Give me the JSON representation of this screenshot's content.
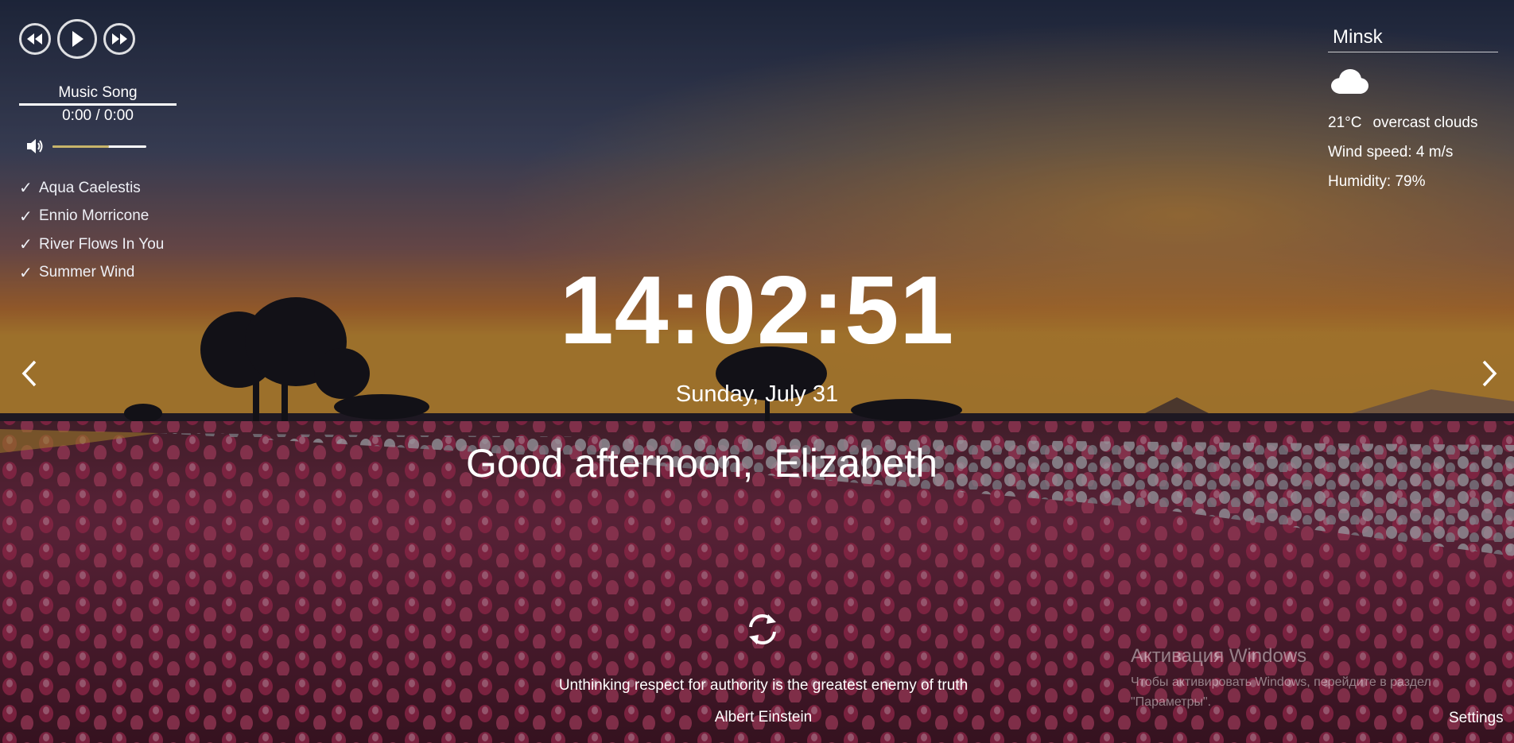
{
  "player": {
    "song_title": "Music Song",
    "time_display": "0:00 / 0:00",
    "volume_level": 0.6,
    "playlist": [
      {
        "title": "Aqua Caelestis"
      },
      {
        "title": "Ennio Morricone"
      },
      {
        "title": "River Flows In You"
      },
      {
        "title": "Summer Wind"
      }
    ],
    "check_mark": "✓",
    "icons": {
      "prev": "rewind-icon",
      "play": "play-icon",
      "next": "fast-forward-icon",
      "volume": "speaker-icon"
    }
  },
  "weather": {
    "city": "Minsk",
    "icon": "cloud-icon",
    "temperature": "21°C",
    "description": "overcast clouds",
    "wind": "Wind speed: 4 m/s",
    "humidity": "Humidity: 79%"
  },
  "clock": {
    "time": "14:02:51",
    "date": "Sunday, July 31"
  },
  "greeting": {
    "text": "Good afternoon,",
    "name": "Elizabeth"
  },
  "quote": {
    "text": "Unthinking respect for authority is the greatest enemy of truth",
    "author": "Albert Einstein",
    "refresh_icon": "refresh-icon"
  },
  "watermark": {
    "title": "Активация Windows",
    "subtitle": "Чтобы активировать Windows, перейдите в раздел \"Параметры\"."
  },
  "settings": {
    "label": "Settings"
  },
  "colors": {
    "text": "#ffffff",
    "volume_fill": "#c8b56a"
  }
}
